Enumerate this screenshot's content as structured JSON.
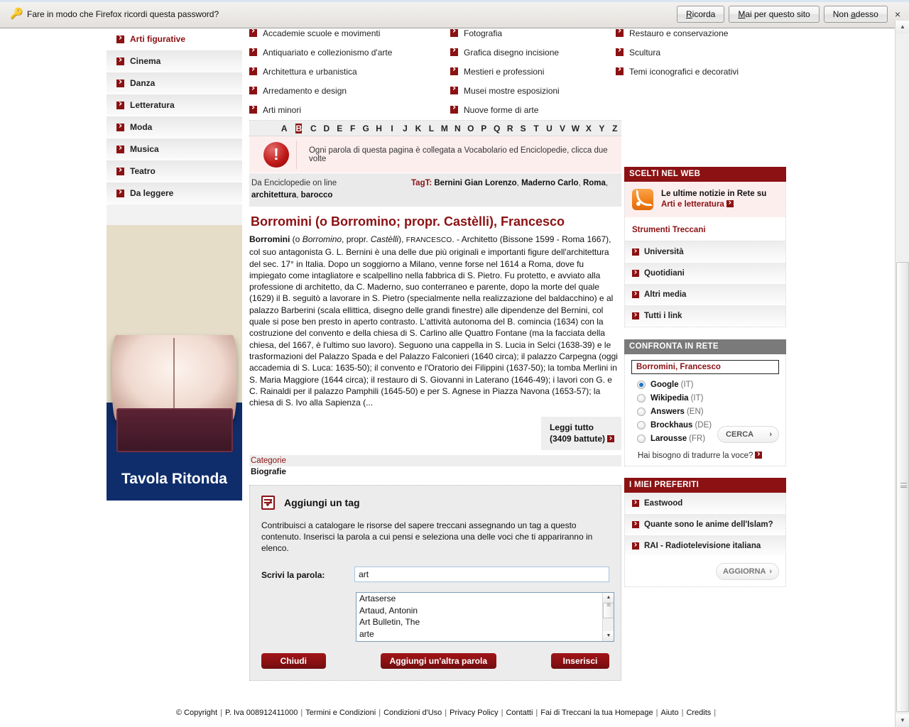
{
  "notification": {
    "icon": "key-icon",
    "message": "Fare in modo che Firefox ricordi questa password?",
    "buttons": [
      {
        "label": "Ricorda",
        "accesskey": "R"
      },
      {
        "label": "Mai per questo sito",
        "accesskey": "M"
      },
      {
        "label": "Non adesso",
        "accesskey": "a"
      }
    ],
    "close": "×"
  },
  "sidebar": {
    "items": [
      {
        "label": "Arti figurative",
        "active": true
      },
      {
        "label": "Cinema",
        "active": false
      },
      {
        "label": "Danza",
        "active": false
      },
      {
        "label": "Letteratura",
        "active": false
      },
      {
        "label": "Moda",
        "active": false
      },
      {
        "label": "Musica",
        "active": false
      },
      {
        "label": "Teatro",
        "active": false
      },
      {
        "label": "Da leggere",
        "active": false
      }
    ],
    "promo": {
      "title": "Tavola Ritonda"
    }
  },
  "categories": {
    "col1": [
      "Accademie scuole e movimenti",
      "Antiquariato e collezionismo d'arte",
      "Architettura e urbanistica",
      "Arredamento e design",
      "Arti minori"
    ],
    "col2": [
      "Fotografia",
      "Grafica disegno incisione",
      "Mestieri e professioni",
      "Musei mostre esposizioni",
      "Nuove forme di arte"
    ],
    "col3": [
      "Restauro e conservazione",
      "Scultura",
      "Temi iconografici e decorativi"
    ]
  },
  "alphabet": {
    "letters": [
      "A",
      "B",
      "C",
      "D",
      "E",
      "F",
      "G",
      "H",
      "I",
      "J",
      "K",
      "L",
      "M",
      "N",
      "O",
      "P",
      "Q",
      "R",
      "S",
      "T",
      "U",
      "V",
      "W",
      "X",
      "Y",
      "Z"
    ],
    "selected": "B"
  },
  "notice": {
    "icon": "exclamation-icon",
    "text": "Ogni parola di questa pagina è collegata a Vocabolario ed Enciclopedie, clicca due volte"
  },
  "article": {
    "source": "Da Enciclopedie on line",
    "tagt_label": "TagT:",
    "tags": [
      "Bernini Gian Lorenzo",
      "Maderno Carlo",
      "Roma",
      "architettura",
      "barocco"
    ],
    "title": "Borromini (o Borromino; propr. Castèlli), Francesco",
    "lead_bold": "Borromini",
    "lead_rest_1": " (o ",
    "lead_italic_1": "Borromino",
    "lead_rest_2": ", propr. ",
    "lead_italic_2": "Castèlli",
    "lead_rest_3": "), ",
    "lead_smallcaps": "FRANCESCO",
    "body": ". - Architetto (Bissone 1599 - Roma 1667), col suo antagonista G. L. Bernini è una delle due più originali e importanti figure dell'architettura del sec. 17° in Italia. Dopo un soggiorno a Milano, venne forse nel 1614 a Roma, dove fu impiegato come intagliatore e scalpellino nella fabbrica di S. Pietro. Fu protetto, e avviato alla professione di architetto, da C. Maderno, suo conterraneo e parente, dopo la morte del quale (1629) il B. seguitò a lavorare in S. Pietro (specialmente nella realizzazione del baldacchino) e al palazzo Barberini (scala ellittica, disegno delle grandi finestre) alle dipendenze del Bernini, col quale si pose ben presto in aperto contrasto. L'attività autonoma del B. comincia (1634) con la costruzione del convento e della chiesa di S. Carlino alle Quattro Fontane (ma la facciata della chiesa, del 1667, è l'ultimo suo lavoro). Seguono una cappella in S. Lucia in Selci (1638-39) e le trasformazioni del Palazzo Spada e del Palazzo Falconieri (1640 circa); il palazzo Carpegna (oggi accademia di S. Luca: 1635-50); il convento e l'Oratorio dei Filippini (1637-50); la tomba Merlini in S. Maria Maggiore (1644 circa); il restauro di S. Giovanni in Laterano (1646-49); i lavori con G. e C. Rainaldi per il palazzo Pamphili (1645-50) e per S. Agnese in Piazza Navona (1653-57); la chiesa di S. Ivo alla Sapienza (...",
    "read_all_label": "Leggi tutto",
    "read_all_count": "(3409 battute)",
    "categories_label": "Categorie",
    "categories_value": "Biografie"
  },
  "tag_form": {
    "icon": "tag-checklist-icon",
    "title": "Aggiungi un tag",
    "description": "Contribuisci a catalogare le risorse del sapere treccani assegnando un tag a questo contenuto. Inserisci la parola a cui pensi e seleziona una delle voci che ti appariranno in elenco.",
    "input_label": "Scrivi la parola:",
    "input_value": "art",
    "input_placeholder": "",
    "suggestions": [
      "Artaserse",
      "Artaud, Antonin",
      "Art Bulletin, The",
      "arte"
    ],
    "buttons": {
      "close": "Chiudi",
      "add_another": "Aggiungi un'altra parola",
      "insert": "Inserisci"
    }
  },
  "right": {
    "web_panel": {
      "header": "SCELTI NEL WEB",
      "rss_icon": "rss-icon",
      "rss_line1": "Le ultime notizie in Rete su",
      "rss_line2": "Arti e letteratura",
      "tools_header": "Strumenti Treccani",
      "items": [
        "Università",
        "Quotidiani",
        "Altri media",
        "Tutti i link"
      ]
    },
    "compare_panel": {
      "header": "CONFRONTA IN RETE",
      "query_value": "Borromini, Francesco",
      "query_placeholder": "",
      "options": [
        {
          "name": "Google",
          "lang": "(IT)",
          "selected": true
        },
        {
          "name": "Wikipedia",
          "lang": "(IT)",
          "selected": false
        },
        {
          "name": "Answers",
          "lang": "(EN)",
          "selected": false
        },
        {
          "name": "Brockhaus",
          "lang": "(DE)",
          "selected": false
        },
        {
          "name": "Larousse",
          "lang": "(FR)",
          "selected": false
        }
      ],
      "search_button": "CERCA",
      "search_button_chevron": "›",
      "translate_link": "Hai bisogno di tradurre la voce?"
    },
    "favorites_panel": {
      "header": "I MIEI PREFERITI",
      "items": [
        "Eastwood",
        "Quante sono le anime dell'Islam?",
        "RAI - Radiotelevisione italiana"
      ],
      "update_button": "AGGIORNA",
      "update_button_chevron": "›"
    }
  },
  "footer": {
    "links": [
      "© Copyright",
      "P. Iva 008912411000",
      "Termini e Condizioni",
      "Condizioni d'Uso",
      "Privacy Policy",
      "Contatti",
      "Fai di Treccani la tua Homepage",
      "Aiuto",
      "Credits"
    ],
    "separator": "|"
  },
  "colors": {
    "brand_red": "#8b1113",
    "panel_gray": "#7a7a7a",
    "notice_bg": "#fdeeee",
    "promo_blue": "#0f2d6b"
  }
}
